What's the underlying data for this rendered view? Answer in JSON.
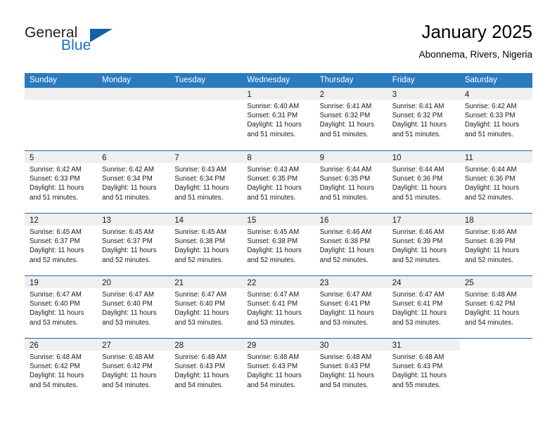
{
  "brand": {
    "name_top": "General",
    "name_bottom": "Blue",
    "triangle_color": "#1461a8",
    "blue_color": "#1a72c4"
  },
  "header": {
    "month_title": "January 2025",
    "location": "Abonnema, Rivers, Nigeria"
  },
  "theme": {
    "header_blue": "#2a7ac0",
    "row_border_blue": "#1a6aad",
    "daynum_band": "#efefef"
  },
  "weekdays": [
    "Sunday",
    "Monday",
    "Tuesday",
    "Wednesday",
    "Thursday",
    "Friday",
    "Saturday"
  ],
  "weeks": [
    [
      {
        "day": "",
        "empty": true
      },
      {
        "day": "",
        "empty": true
      },
      {
        "day": "",
        "empty": true
      },
      {
        "day": "1",
        "sunrise": "Sunrise: 6:40 AM",
        "sunset": "Sunset: 6:31 PM",
        "daylight1": "Daylight: 11 hours",
        "daylight2": "and 51 minutes."
      },
      {
        "day": "2",
        "sunrise": "Sunrise: 6:41 AM",
        "sunset": "Sunset: 6:32 PM",
        "daylight1": "Daylight: 11 hours",
        "daylight2": "and 51 minutes."
      },
      {
        "day": "3",
        "sunrise": "Sunrise: 6:41 AM",
        "sunset": "Sunset: 6:32 PM",
        "daylight1": "Daylight: 11 hours",
        "daylight2": "and 51 minutes."
      },
      {
        "day": "4",
        "sunrise": "Sunrise: 6:42 AM",
        "sunset": "Sunset: 6:33 PM",
        "daylight1": "Daylight: 11 hours",
        "daylight2": "and 51 minutes."
      }
    ],
    [
      {
        "day": "5",
        "sunrise": "Sunrise: 6:42 AM",
        "sunset": "Sunset: 6:33 PM",
        "daylight1": "Daylight: 11 hours",
        "daylight2": "and 51 minutes."
      },
      {
        "day": "6",
        "sunrise": "Sunrise: 6:42 AM",
        "sunset": "Sunset: 6:34 PM",
        "daylight1": "Daylight: 11 hours",
        "daylight2": "and 51 minutes."
      },
      {
        "day": "7",
        "sunrise": "Sunrise: 6:43 AM",
        "sunset": "Sunset: 6:34 PM",
        "daylight1": "Daylight: 11 hours",
        "daylight2": "and 51 minutes."
      },
      {
        "day": "8",
        "sunrise": "Sunrise: 6:43 AM",
        "sunset": "Sunset: 6:35 PM",
        "daylight1": "Daylight: 11 hours",
        "daylight2": "and 51 minutes."
      },
      {
        "day": "9",
        "sunrise": "Sunrise: 6:44 AM",
        "sunset": "Sunset: 6:35 PM",
        "daylight1": "Daylight: 11 hours",
        "daylight2": "and 51 minutes."
      },
      {
        "day": "10",
        "sunrise": "Sunrise: 6:44 AM",
        "sunset": "Sunset: 6:36 PM",
        "daylight1": "Daylight: 11 hours",
        "daylight2": "and 51 minutes."
      },
      {
        "day": "11",
        "sunrise": "Sunrise: 6:44 AM",
        "sunset": "Sunset: 6:36 PM",
        "daylight1": "Daylight: 11 hours",
        "daylight2": "and 52 minutes."
      }
    ],
    [
      {
        "day": "12",
        "sunrise": "Sunrise: 6:45 AM",
        "sunset": "Sunset: 6:37 PM",
        "daylight1": "Daylight: 11 hours",
        "daylight2": "and 52 minutes."
      },
      {
        "day": "13",
        "sunrise": "Sunrise: 6:45 AM",
        "sunset": "Sunset: 6:37 PM",
        "daylight1": "Daylight: 11 hours",
        "daylight2": "and 52 minutes."
      },
      {
        "day": "14",
        "sunrise": "Sunrise: 6:45 AM",
        "sunset": "Sunset: 6:38 PM",
        "daylight1": "Daylight: 11 hours",
        "daylight2": "and 52 minutes."
      },
      {
        "day": "15",
        "sunrise": "Sunrise: 6:45 AM",
        "sunset": "Sunset: 6:38 PM",
        "daylight1": "Daylight: 11 hours",
        "daylight2": "and 52 minutes."
      },
      {
        "day": "16",
        "sunrise": "Sunrise: 6:46 AM",
        "sunset": "Sunset: 6:38 PM",
        "daylight1": "Daylight: 11 hours",
        "daylight2": "and 52 minutes."
      },
      {
        "day": "17",
        "sunrise": "Sunrise: 6:46 AM",
        "sunset": "Sunset: 6:39 PM",
        "daylight1": "Daylight: 11 hours",
        "daylight2": "and 52 minutes."
      },
      {
        "day": "18",
        "sunrise": "Sunrise: 6:46 AM",
        "sunset": "Sunset: 6:39 PM",
        "daylight1": "Daylight: 11 hours",
        "daylight2": "and 52 minutes."
      }
    ],
    [
      {
        "day": "19",
        "sunrise": "Sunrise: 6:47 AM",
        "sunset": "Sunset: 6:40 PM",
        "daylight1": "Daylight: 11 hours",
        "daylight2": "and 53 minutes."
      },
      {
        "day": "20",
        "sunrise": "Sunrise: 6:47 AM",
        "sunset": "Sunset: 6:40 PM",
        "daylight1": "Daylight: 11 hours",
        "daylight2": "and 53 minutes."
      },
      {
        "day": "21",
        "sunrise": "Sunrise: 6:47 AM",
        "sunset": "Sunset: 6:40 PM",
        "daylight1": "Daylight: 11 hours",
        "daylight2": "and 53 minutes."
      },
      {
        "day": "22",
        "sunrise": "Sunrise: 6:47 AM",
        "sunset": "Sunset: 6:41 PM",
        "daylight1": "Daylight: 11 hours",
        "daylight2": "and 53 minutes."
      },
      {
        "day": "23",
        "sunrise": "Sunrise: 6:47 AM",
        "sunset": "Sunset: 6:41 PM",
        "daylight1": "Daylight: 11 hours",
        "daylight2": "and 53 minutes."
      },
      {
        "day": "24",
        "sunrise": "Sunrise: 6:47 AM",
        "sunset": "Sunset: 6:41 PM",
        "daylight1": "Daylight: 11 hours",
        "daylight2": "and 53 minutes."
      },
      {
        "day": "25",
        "sunrise": "Sunrise: 6:48 AM",
        "sunset": "Sunset: 6:42 PM",
        "daylight1": "Daylight: 11 hours",
        "daylight2": "and 54 minutes."
      }
    ],
    [
      {
        "day": "26",
        "sunrise": "Sunrise: 6:48 AM",
        "sunset": "Sunset: 6:42 PM",
        "daylight1": "Daylight: 11 hours",
        "daylight2": "and 54 minutes."
      },
      {
        "day": "27",
        "sunrise": "Sunrise: 6:48 AM",
        "sunset": "Sunset: 6:42 PM",
        "daylight1": "Daylight: 11 hours",
        "daylight2": "and 54 minutes."
      },
      {
        "day": "28",
        "sunrise": "Sunrise: 6:48 AM",
        "sunset": "Sunset: 6:43 PM",
        "daylight1": "Daylight: 11 hours",
        "daylight2": "and 54 minutes."
      },
      {
        "day": "29",
        "sunrise": "Sunrise: 6:48 AM",
        "sunset": "Sunset: 6:43 PM",
        "daylight1": "Daylight: 11 hours",
        "daylight2": "and 54 minutes."
      },
      {
        "day": "30",
        "sunrise": "Sunrise: 6:48 AM",
        "sunset": "Sunset: 6:43 PM",
        "daylight1": "Daylight: 11 hours",
        "daylight2": "and 54 minutes."
      },
      {
        "day": "31",
        "sunrise": "Sunrise: 6:48 AM",
        "sunset": "Sunset: 6:43 PM",
        "daylight1": "Daylight: 11 hours",
        "daylight2": "and 55 minutes."
      },
      {
        "day": "",
        "empty": true,
        "noband": true
      }
    ]
  ]
}
